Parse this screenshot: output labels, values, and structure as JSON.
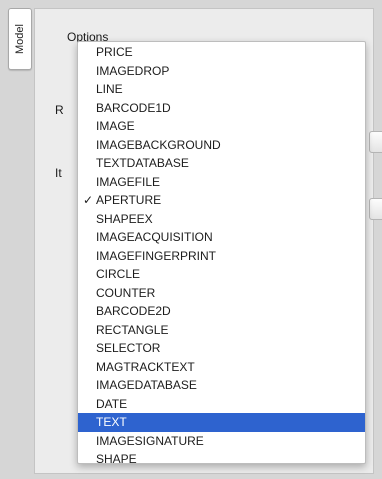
{
  "side_tab": {
    "label": "Model"
  },
  "panel": {
    "options_label": "Options",
    "partial_label_1": "R",
    "partial_label_2": "It"
  },
  "dropdown": {
    "checked_item": "APERTURE",
    "highlighted_item": "TEXT",
    "items": [
      "PRICE",
      "IMAGEDROP",
      "LINE",
      "BARCODE1D",
      "IMAGE",
      "IMAGEBACKGROUND",
      "TEXTDATABASE",
      "IMAGEFILE",
      "APERTURE",
      "SHAPEEX",
      "IMAGEACQUISITION",
      "IMAGEFINGERPRINT",
      "CIRCLE",
      "COUNTER",
      "BARCODE2D",
      "RECTANGLE",
      "SELECTOR",
      "MAGTRACKTEXT",
      "IMAGEDATABASE",
      "DATE",
      "TEXT",
      "IMAGESIGNATURE",
      "SHAPE"
    ]
  },
  "colors": {
    "highlight": "#2e63cf",
    "panel_bg": "#ececec"
  }
}
